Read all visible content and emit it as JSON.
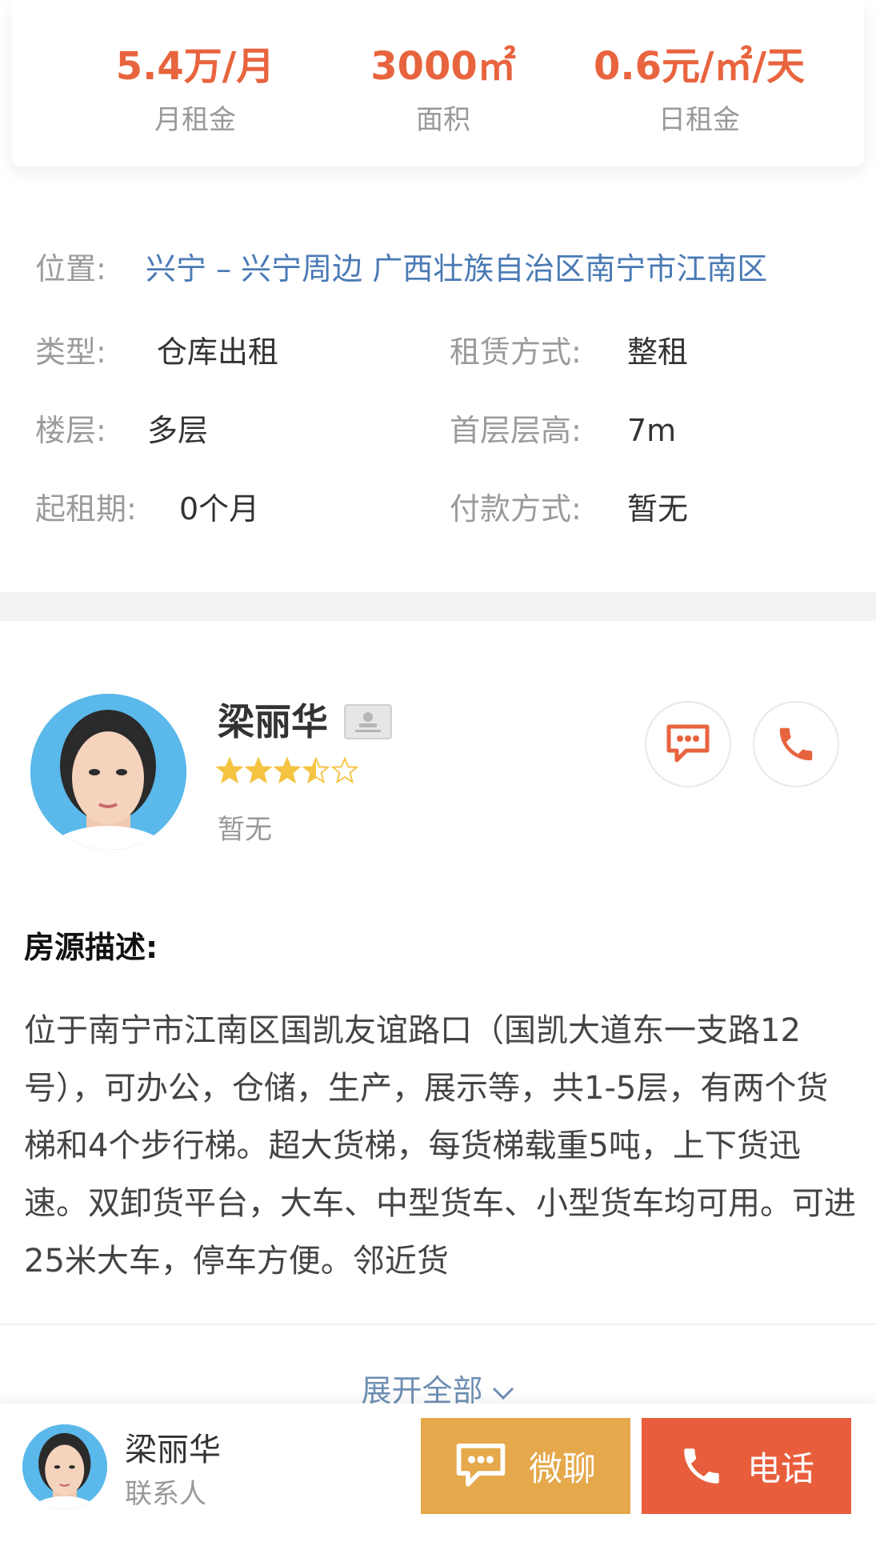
{
  "stats": {
    "monthly_rent": "5.4万/月",
    "monthly_rent_label": "月租金",
    "area": "3000㎡",
    "area_label": "面积",
    "daily_rent": "0.6元/㎡/天",
    "daily_rent_label": "日租金"
  },
  "info": {
    "location_key": "位置:",
    "location_val": "兴宁 – 兴宁周边 广西壮族自治区南宁市江南区",
    "type_key": "类型:",
    "type_val": "仓库出租",
    "lease_key": "租赁方式:",
    "lease_val": "整租",
    "floor_key": "楼层:",
    "floor_val": "多层",
    "height_key": "首层层高:",
    "height_val": "7m",
    "min_term_key": "起租期:",
    "min_term_val": "0个月",
    "payment_key": "付款方式:",
    "payment_val": "暂无"
  },
  "agent": {
    "name": "梁丽华",
    "rating": 3.5,
    "rating_max": 5,
    "subtitle": "暂无",
    "chat_icon": "chat-bubble-icon",
    "phone_icon": "phone-icon"
  },
  "description": {
    "title": "房源描述:",
    "body": "位于南宁市江南区国凯友谊路口（国凯大道东一支路12号），可办公，仓储，生产，展示等，共1-5层，有两个货梯和4个步行梯。超大货梯，每货梯载重5吨，上下货迅速。双卸货平台，大车、中型货车、小型货车均可用。可进25米大车，停车方便。邻近货",
    "expand_label": "展开全部"
  },
  "bottom_bar": {
    "name": "梁丽华",
    "role": "联系人",
    "chat_label": "微聊",
    "call_label": "电话"
  },
  "colors": {
    "accent_orange": "#e8643e",
    "link_blue": "#4a7ab5",
    "chat_button": "#e5a84a",
    "call_button": "#e85e3c",
    "star": "#f5c342"
  }
}
